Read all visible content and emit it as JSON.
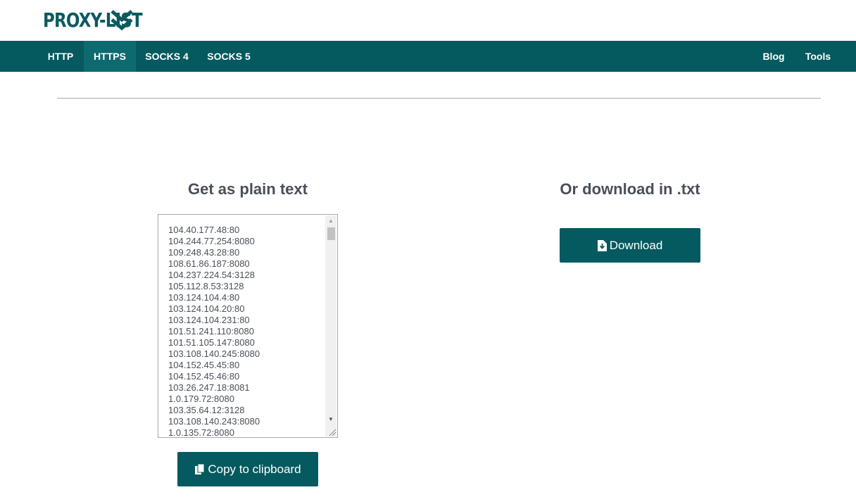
{
  "brand": {
    "logo_text": "PROXY-LIST"
  },
  "nav": {
    "left": [
      {
        "label": "HTTP"
      },
      {
        "label": "HTTPS"
      },
      {
        "label": "SOCKS 4"
      },
      {
        "label": "SOCKS 5"
      }
    ],
    "active": "HTTPS",
    "right": [
      {
        "label": "Blog"
      },
      {
        "label": "Tools"
      }
    ]
  },
  "plain_text": {
    "title": "Get as plain text",
    "proxies": [
      "104.40.177.48:80",
      "104.244.77.254:8080",
      "109.248.43.28:80",
      "108.61.86.187:8080",
      "104.237.224.54:3128",
      "105.112.8.53:3128",
      "103.124.104.4:80",
      "103.124.104.20:80",
      "103.124.104.231:80",
      "101.51.241.110:8080",
      "101.51.105.147:8080",
      "103.108.140.245:8080",
      "104.152.45.45:80",
      "104.152.45.46:80",
      "103.26.247.18:8081",
      "1.0.179.72:8080",
      "103.35.64.12:3128",
      "103.108.140.243:8080",
      "1.0.135.72:8080"
    ],
    "copy_button": "Copy to clipboard",
    "copy_icon": "copy-icon"
  },
  "download": {
    "title": "Or download in .txt",
    "button": "Download",
    "button_icon": "file-download-icon"
  },
  "colors": {
    "primary": "#045a5f",
    "active_nav": "#0d6b70",
    "text": "#4a4f57"
  }
}
